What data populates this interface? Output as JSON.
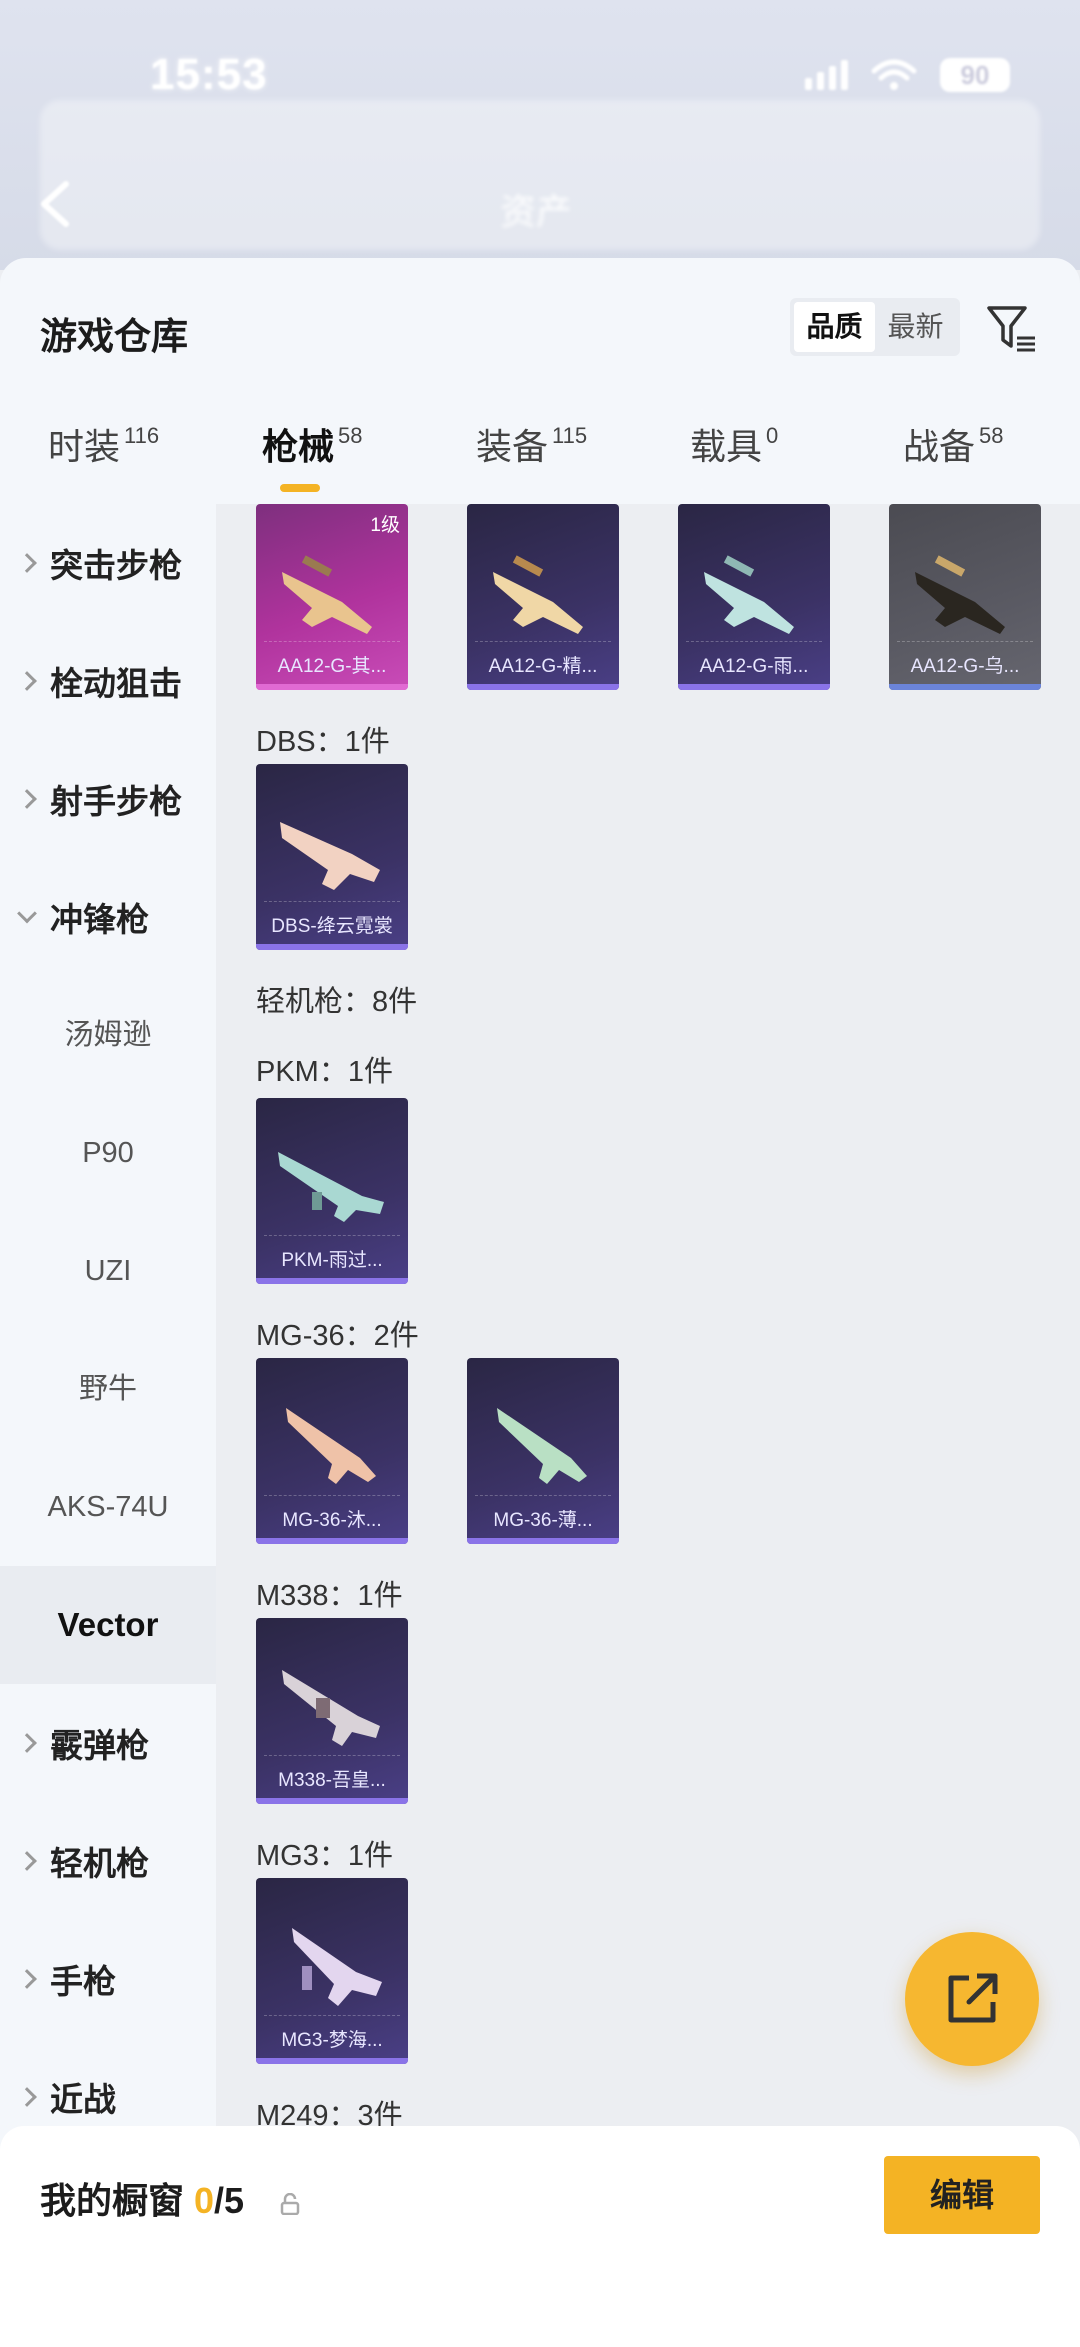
{
  "status_bar": {
    "time": "15:53",
    "battery": "90"
  },
  "backdrop": {
    "title": "资产"
  },
  "header": {
    "title": "游戏仓库",
    "sort_options": [
      "品质",
      "最新"
    ],
    "sort_active": "品质"
  },
  "tabs": [
    {
      "label": "时装",
      "count": "116"
    },
    {
      "label": "枪械",
      "count": "58"
    },
    {
      "label": "装备",
      "count": "115"
    },
    {
      "label": "载具",
      "count": "0"
    },
    {
      "label": "战备",
      "count": "58"
    }
  ],
  "sidebar": {
    "categories": [
      {
        "label": "突击步枪"
      },
      {
        "label": "栓动狙击"
      },
      {
        "label": "射手步枪"
      },
      {
        "label": "冲锋枪"
      },
      {
        "label": "霰弹枪"
      },
      {
        "label": "轻机枪"
      },
      {
        "label": "手枪"
      },
      {
        "label": "近战"
      }
    ],
    "sub_items": [
      "汤姆逊",
      "P90",
      "UZI",
      "野牛",
      "AKS-74U",
      "Vector"
    ]
  },
  "content": {
    "cards_aa12": [
      {
        "name": "AA12-G-其...",
        "level": "1级"
      },
      {
        "name": "AA12-G-精..."
      },
      {
        "name": "AA12-G-雨..."
      },
      {
        "name": "AA12-G-乌..."
      }
    ],
    "groups": {
      "dbs": {
        "label": "DBS：1件",
        "cards": [
          "DBS-绛云霓裳"
        ]
      },
      "lmg": {
        "label": "轻机枪：8件"
      },
      "pkm": {
        "label": "PKM：1件",
        "cards": [
          "PKM-雨过..."
        ]
      },
      "mg36": {
        "label": "MG-36：2件",
        "cards": [
          "MG-36-沐...",
          "MG-36-薄..."
        ]
      },
      "m338": {
        "label": "M338：1件",
        "cards": [
          "M338-吾皇..."
        ]
      },
      "mg3": {
        "label": "MG3：1件",
        "cards": [
          "MG3-梦海..."
        ]
      },
      "m249": {
        "label": "M249：3件"
      }
    }
  },
  "bottom_bar": {
    "label": "我的橱窗",
    "current": "0",
    "total": "/5",
    "edit_label": "编辑"
  },
  "colors": {
    "accent": "#f4b324",
    "card_purple": "#3b3265",
    "card_pink": "#b0339d",
    "card_gray": "#5a5a63"
  }
}
